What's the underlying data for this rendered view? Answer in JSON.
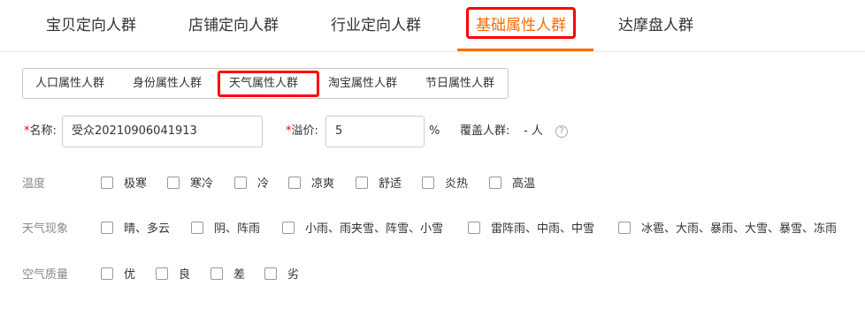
{
  "tabs": [
    {
      "label": "宝贝定向人群"
    },
    {
      "label": "店铺定向人群"
    },
    {
      "label": "行业定向人群"
    },
    {
      "label": "基础属性人群"
    },
    {
      "label": "达摩盘人群"
    }
  ],
  "subtabs": [
    {
      "label": "人口属性人群"
    },
    {
      "label": "身份属性人群"
    },
    {
      "label": "天气属性人群"
    },
    {
      "label": "淘宝属性人群"
    },
    {
      "label": "节日属性人群"
    }
  ],
  "form": {
    "required_mark": "*",
    "name_label": "名称:",
    "name_value": "受众20210906041913",
    "premium_label": "溢价:",
    "premium_value": "5",
    "percent": "%",
    "coverage_label": "覆盖人群:",
    "coverage_value": "- 人",
    "help_glyph": "?"
  },
  "attributes": {
    "temperature": {
      "label": "温度",
      "options": [
        "极寒",
        "寒冷",
        "冷",
        "凉爽",
        "舒适",
        "炎热",
        "高温"
      ]
    },
    "weather": {
      "label": "天气现象",
      "options": [
        "晴、多云",
        "阴、阵雨",
        "小雨、雨夹雪、阵雪、小雪",
        "雷阵雨、中雨、中雪",
        "冰雹、大雨、暴雨、大雪、暴雪、冻雨"
      ]
    },
    "air": {
      "label": "空气质量",
      "options": [
        "优",
        "良",
        "差",
        "劣"
      ]
    }
  },
  "colors": {
    "accent": "#ff6a00",
    "highlight": "#ff0000"
  },
  "icons": {
    "help": "question-circle-icon",
    "checkbox": "checkbox-unchecked"
  }
}
